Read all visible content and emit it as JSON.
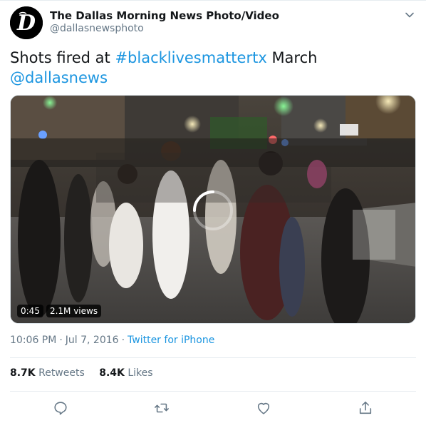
{
  "account": {
    "name": "The Dallas Morning News Photo/Video",
    "handle": "@dallasnewsphoto",
    "avatar_letter": "D"
  },
  "tweet": {
    "text_plain_1": "Shots fired at ",
    "hashtag": "#blacklivesmattertx",
    "text_plain_2": " March",
    "mention": "@dallasnews"
  },
  "media": {
    "duration": "0:45",
    "views": "2.1M views",
    "state": "loading"
  },
  "meta": {
    "time": "10:06 PM",
    "date": "Jul 7, 2016",
    "source": "Twitter for iPhone",
    "separator": "·"
  },
  "stats": {
    "retweets_count": "8.7K",
    "retweets_label": "Retweets",
    "likes_count": "8.4K",
    "likes_label": "Likes"
  },
  "icons": {
    "menu": "chevron-down-icon",
    "reply": "reply-icon",
    "retweet": "retweet-icon",
    "like": "heart-icon",
    "share": "share-icon"
  },
  "colors": {
    "link": "#1b95e0",
    "secondary_text": "#657786",
    "primary_text": "#14171a"
  }
}
